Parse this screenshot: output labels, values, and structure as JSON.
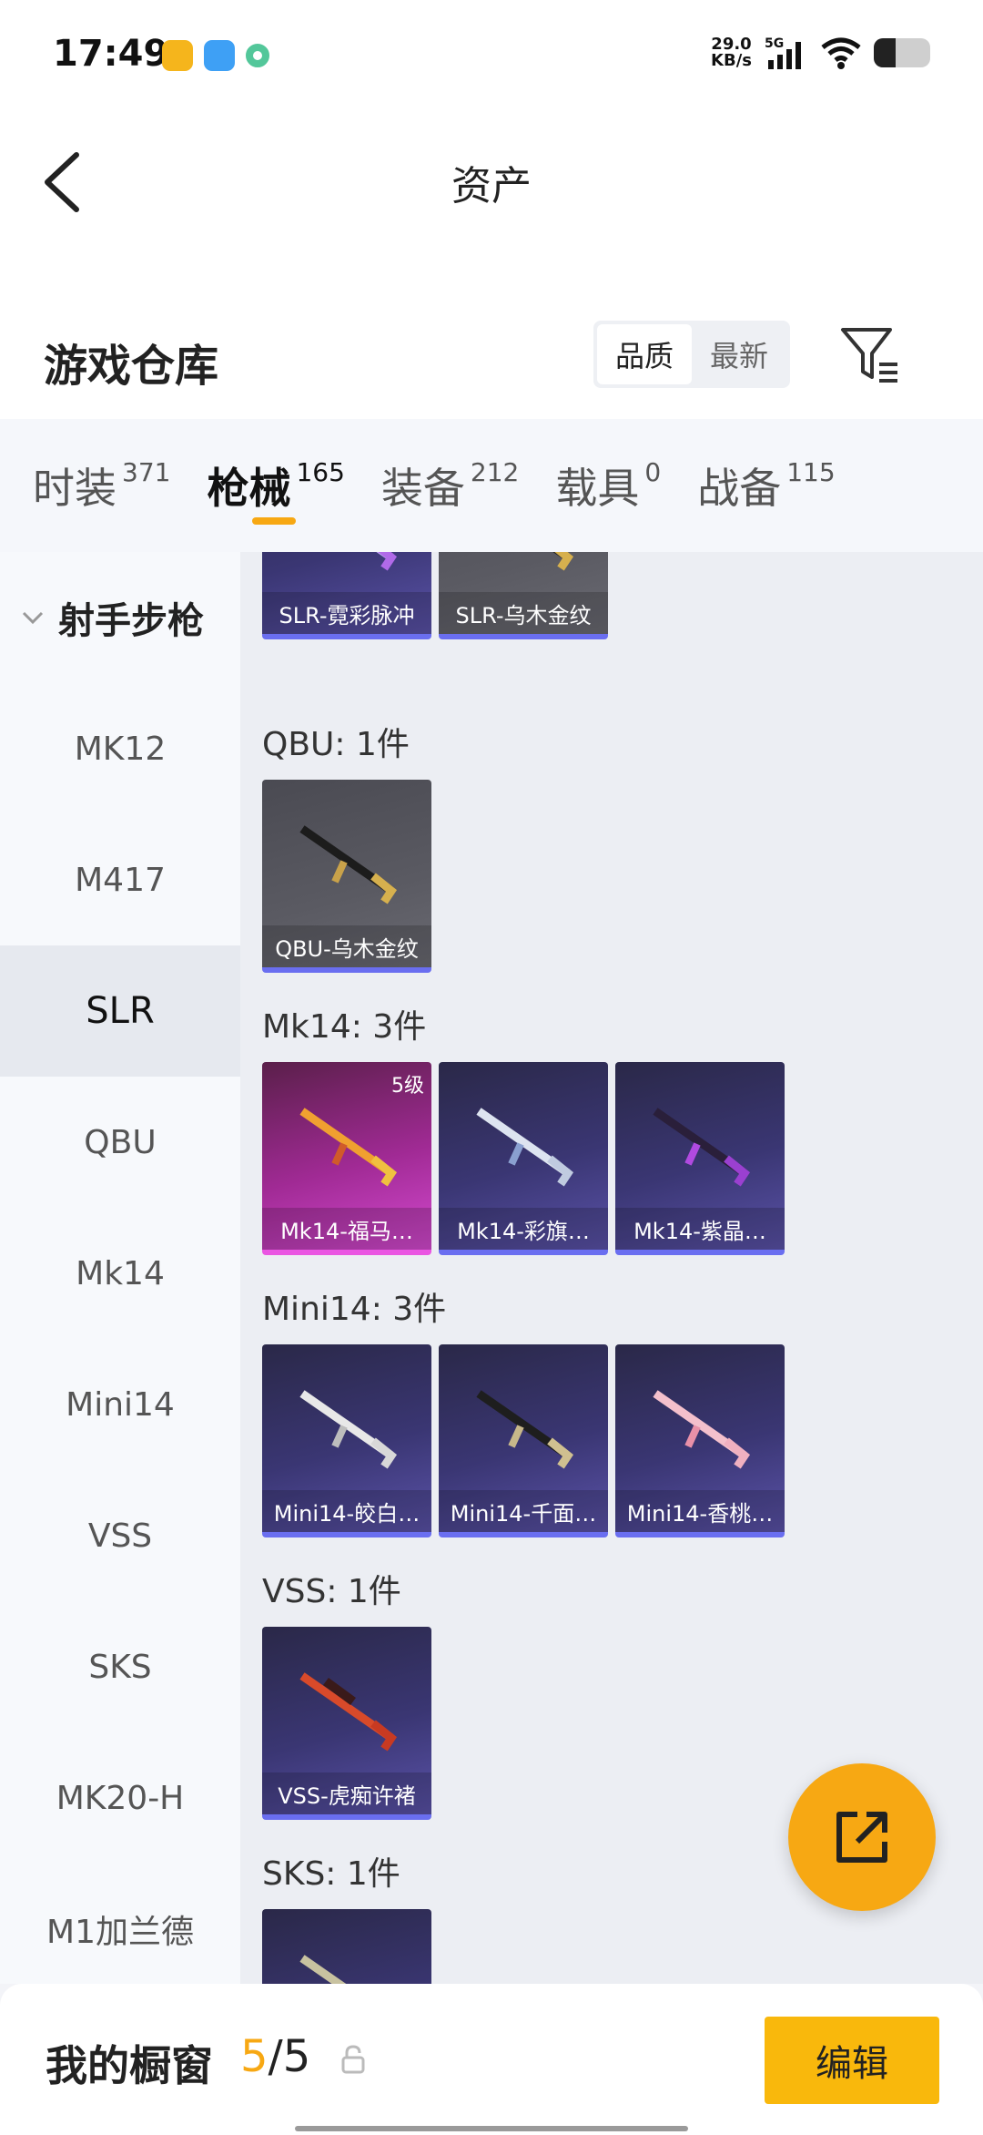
{
  "status": {
    "time": "17:49",
    "speed_value": "29.0",
    "speed_unit": "KB/s",
    "network": "5G"
  },
  "header": {
    "title": "资产"
  },
  "repo": {
    "label": "游戏仓库",
    "sort_quality": "品质",
    "sort_newest": "最新"
  },
  "tabs": [
    {
      "name": "时装",
      "count": "371"
    },
    {
      "name": "枪械",
      "count": "165"
    },
    {
      "name": "装备",
      "count": "212"
    },
    {
      "name": "载具",
      "count": "0"
    },
    {
      "name": "战备",
      "count": "115"
    }
  ],
  "sidebar": {
    "category": "射手步枪",
    "items": [
      "MK12",
      "M417",
      "SLR",
      "QBU",
      "Mk14",
      "Mini14",
      "VSS",
      "SKS",
      "MK20-H",
      "M1加兰德"
    ]
  },
  "sections": {
    "slr": {
      "cards": [
        "SLR-霓彩脉冲",
        "SLR-乌木金纹"
      ]
    },
    "qbu": {
      "title": "QBU: 1件",
      "cards": [
        "QBU-乌木金纹"
      ]
    },
    "mk14": {
      "title": "Mk14: 3件",
      "cards": [
        "Mk14-福马…",
        "Mk14-彩旗…",
        "Mk14-紫晶…"
      ],
      "level_badge": "5级"
    },
    "mini14": {
      "title": "Mini14: 3件",
      "cards": [
        "Mini14-皎白…",
        "Mini14-千面…",
        "Mini14-香桃…"
      ]
    },
    "vss": {
      "title": "VSS: 1件",
      "cards": [
        "VSS-虎痴许褚"
      ]
    },
    "sks": {
      "title": "SKS: 1件"
    }
  },
  "bottom": {
    "label": "我的橱窗",
    "current": "5",
    "sep_total": "/5",
    "edit": "编辑"
  },
  "colors": {
    "accent": "#f7a813",
    "card_purple": "#3a3673",
    "card_gray": "#5a5a62",
    "card_pink": "#a02a94"
  }
}
